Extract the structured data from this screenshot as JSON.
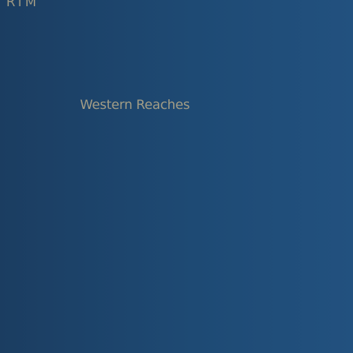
{
  "map": {
    "corner_text": "RTM",
    "region_label": "Western Reaches",
    "colors": {
      "background_left": "#1b3d61",
      "background_right": "#22517f",
      "label_text": "#a19c86"
    }
  }
}
